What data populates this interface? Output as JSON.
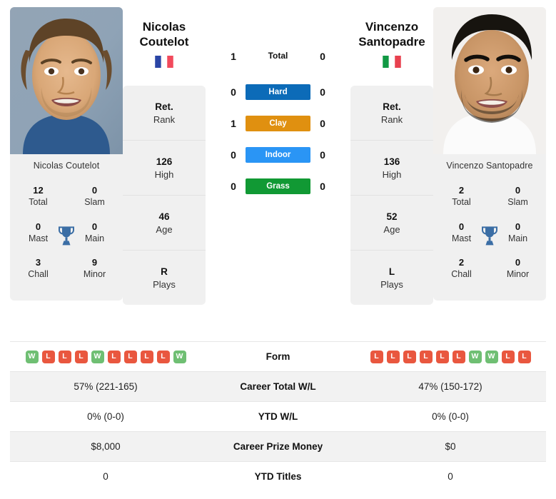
{
  "players": {
    "left": {
      "first_name": "Nicolas",
      "last_name": "Coutelot",
      "full_name": "Nicolas Coutelot",
      "country": "France",
      "flag_icon": "flag-france-icon",
      "info": [
        {
          "value": "Ret.",
          "label": "Rank"
        },
        {
          "value": "126",
          "label": "High"
        },
        {
          "value": "46",
          "label": "Age"
        },
        {
          "value": "R",
          "label": "Plays"
        }
      ],
      "titles": [
        {
          "value": "12",
          "label": "Total"
        },
        {
          "value": "0",
          "label": "Slam"
        },
        {
          "value": "0",
          "label": "Mast"
        },
        {
          "value": "0",
          "label": "Main"
        },
        {
          "value": "3",
          "label": "Chall"
        },
        {
          "value": "9",
          "label": "Minor"
        }
      ],
      "form": [
        "W",
        "L",
        "L",
        "L",
        "W",
        "L",
        "L",
        "L",
        "L",
        "W"
      ],
      "career_total_wl": "57% (221-165)",
      "ytd_wl": "0% (0-0)",
      "career_prize_money": "$8,000",
      "ytd_titles": "0"
    },
    "right": {
      "first_name": "Vincenzo",
      "last_name": "Santopadre",
      "full_name": "Vincenzo Santopadre",
      "country": "Italy",
      "flag_icon": "flag-italy-icon",
      "info": [
        {
          "value": "Ret.",
          "label": "Rank"
        },
        {
          "value": "136",
          "label": "High"
        },
        {
          "value": "52",
          "label": "Age"
        },
        {
          "value": "L",
          "label": "Plays"
        }
      ],
      "titles": [
        {
          "value": "2",
          "label": "Total"
        },
        {
          "value": "0",
          "label": "Slam"
        },
        {
          "value": "0",
          "label": "Mast"
        },
        {
          "value": "0",
          "label": "Main"
        },
        {
          "value": "2",
          "label": "Chall"
        },
        {
          "value": "0",
          "label": "Minor"
        }
      ],
      "form": [
        "L",
        "L",
        "L",
        "L",
        "L",
        "L",
        "W",
        "W",
        "L",
        "L"
      ],
      "career_total_wl": "47% (150-172)",
      "ytd_wl": "0% (0-0)",
      "career_prize_money": "$0",
      "ytd_titles": "0"
    }
  },
  "h2h": [
    {
      "surface": "Total",
      "left": "1",
      "right": "0",
      "color": "transparent",
      "text_color": "#111111"
    },
    {
      "surface": "Hard",
      "left": "0",
      "right": "0",
      "color": "#0c6bb8",
      "text_color": "#ffffff"
    },
    {
      "surface": "Clay",
      "left": "1",
      "right": "0",
      "color": "#e09010",
      "text_color": "#ffffff"
    },
    {
      "surface": "Indoor",
      "left": "0",
      "right": "0",
      "color": "#2a95f5",
      "text_color": "#ffffff"
    },
    {
      "surface": "Grass",
      "left": "0",
      "right": "0",
      "color": "#119934",
      "text_color": "#ffffff"
    }
  ],
  "comparison_rows": [
    {
      "label": "Form",
      "key": "form",
      "type": "form"
    },
    {
      "label": "Career Total W/L",
      "key": "career_total_wl",
      "type": "text"
    },
    {
      "label": "YTD W/L",
      "key": "ytd_wl",
      "type": "text"
    },
    {
      "label": "Career Prize Money",
      "key": "career_prize_money",
      "type": "text"
    },
    {
      "label": "YTD Titles",
      "key": "ytd_titles",
      "type": "text"
    }
  ],
  "colors": {
    "win_badge": "#6fbf73",
    "loss_badge": "#e9573f",
    "card_bg": "#f0f0f0",
    "row_alt_bg": "#f2f2f2",
    "trophy": "#3b6ea5"
  },
  "trophy_icon": "trophy-icon"
}
